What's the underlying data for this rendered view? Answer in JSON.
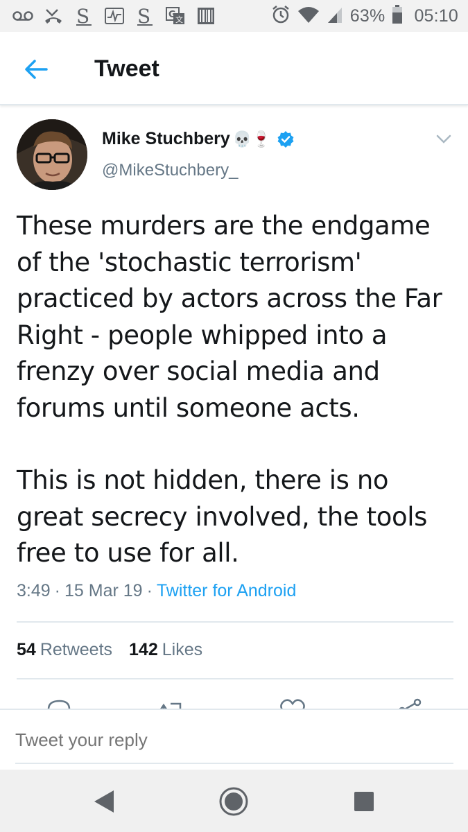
{
  "status_bar": {
    "battery_percent": "63%",
    "time": "05:10",
    "icons": [
      "voicemail-icon",
      "missed-call-icon",
      "app-s-icon",
      "activity-icon",
      "app-s-icon",
      "translate-icon",
      "barcode-icon",
      "alarm-icon",
      "wifi-icon",
      "signal-icon",
      "battery-icon"
    ]
  },
  "header": {
    "title": "Tweet"
  },
  "tweet": {
    "author_name": "Mike Stuchbery",
    "author_emoji": "💀🍷",
    "handle": "@MikeStuchbery_",
    "paragraphs": [
      "These murders are the endgame of the 'stochastic terrorism' practiced by actors across the Far Right - people whipped into a frenzy over social media and forums until someone acts.",
      "This is not hidden, there is no great secrecy involved, the tools free to use for all."
    ],
    "time": "3:49",
    "date": "15 Mar 19",
    "source": "Twitter for Android",
    "retweets_count": "54",
    "retweets_label": "Retweets",
    "likes_count": "142",
    "likes_label": "Likes"
  },
  "reply": {
    "placeholder": "Tweet your reply"
  },
  "colors": {
    "accent": "#1da1f2",
    "text": "#14171a",
    "muted": "#657786",
    "divider": "#e1e8ed"
  }
}
